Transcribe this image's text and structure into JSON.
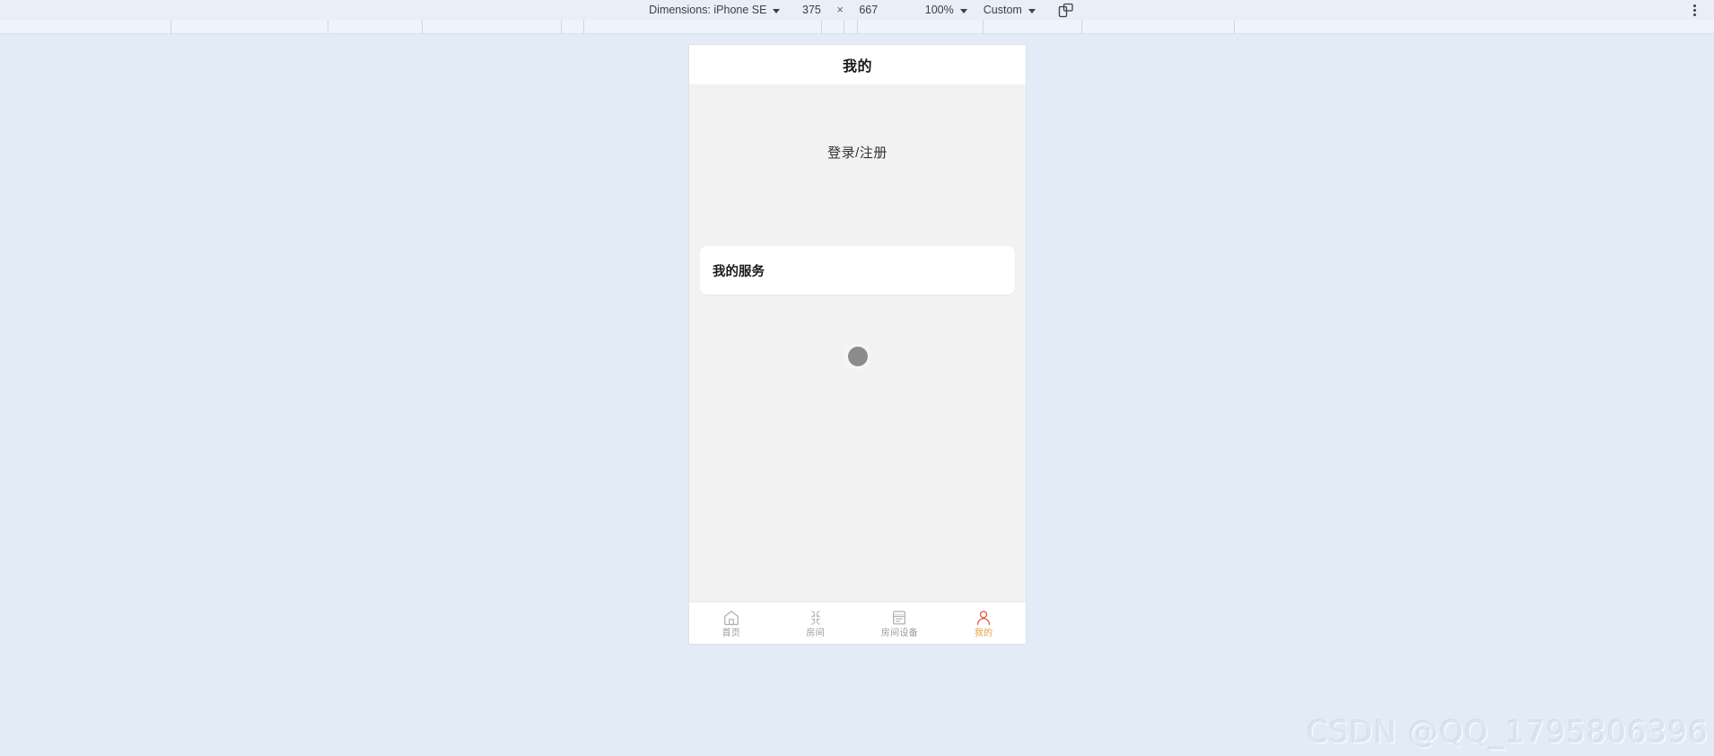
{
  "devtools": {
    "dimensions_label": "Dimensions: iPhone SE",
    "width_value": "375",
    "times_symbol": "×",
    "height_value": "667",
    "zoom_value": "100%",
    "throttle_value": "Custom",
    "rotate_icon": "rotate-device-icon",
    "menu_icon": "more-options-icon"
  },
  "ruler": {
    "ticks": [
      190,
      365,
      470,
      625,
      650,
      915,
      940,
      955,
      1095,
      1205,
      1375
    ]
  },
  "phone": {
    "header": {
      "title": "我的"
    },
    "profile": {
      "login_label": "登录/注册"
    },
    "service_card": {
      "title": "我的服务"
    },
    "loading": {
      "name": "loading-indicator"
    },
    "tabs": [
      {
        "label": "首页",
        "icon": "home-icon",
        "active": false
      },
      {
        "label": "房间",
        "icon": "clover-grid-icon",
        "active": false
      },
      {
        "label": "房间设备",
        "icon": "device-panel-icon",
        "active": false
      },
      {
        "label": "我的",
        "icon": "person-icon",
        "active": true
      }
    ],
    "colors": {
      "active_label": "#e8a33d",
      "active_icon": "#e35b4a",
      "inactive": "#9a9a9a",
      "body_bg": "#f2f2f2",
      "card_bg": "#ffffff"
    }
  },
  "watermark": {
    "text": "CSDN @QQ_1795806396"
  }
}
